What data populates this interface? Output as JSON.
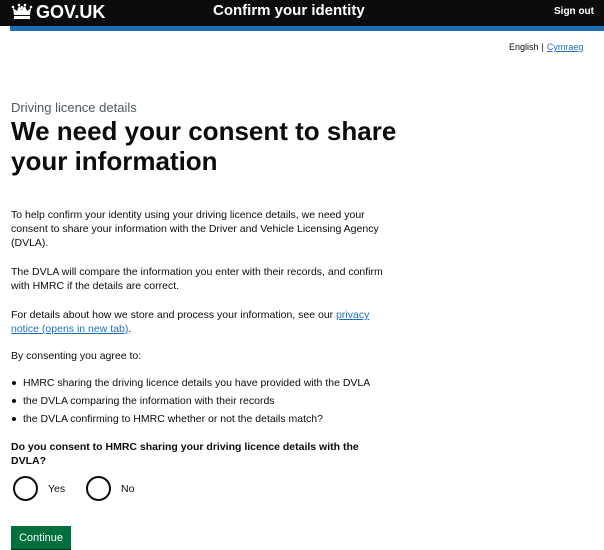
{
  "header": {
    "logo_text": "GOV.UK",
    "service_name": "Confirm your identity",
    "sign_out": "Sign out"
  },
  "language": {
    "current": "English",
    "separator": "|",
    "alternate": "Cymraeg"
  },
  "main": {
    "caption": "Driving licence details",
    "heading": "We need your consent to share your information",
    "paragraphs": [
      "To help confirm your identity using your driving licence details, we need your consent to share your information with the Driver and Vehicle Licensing Agency (DVLA).",
      "The DVLA will compare the information you enter with their records, and confirm with HMRC if the details are correct."
    ],
    "privacy": {
      "prefix": "For details about how we store and process your information, see our ",
      "link": "privacy notice (opens in new tab)",
      "suffix": "."
    },
    "agree_intro": "By consenting you agree to:",
    "bullets": [
      "HMRC sharing the driving licence details you have provided with the DVLA",
      "the DVLA comparing the information with their records",
      "the DVLA confirming to HMRC whether or not the details match?"
    ],
    "question": "Do you consent to HMRC sharing your driving licence details with the DVLA?",
    "options": [
      {
        "label": "Yes",
        "selected": false
      },
      {
        "label": "No",
        "selected": false
      }
    ],
    "continue_button": "Continue"
  },
  "colors": {
    "header_bg": "#0b0c0c",
    "accent_blue": "#1d70b8",
    "button_green": "#00703c",
    "text": "#0b0c0c",
    "secondary_text": "#505a5f"
  },
  "icons": {
    "logo": "crown-icon",
    "radio": "radio-circle"
  }
}
